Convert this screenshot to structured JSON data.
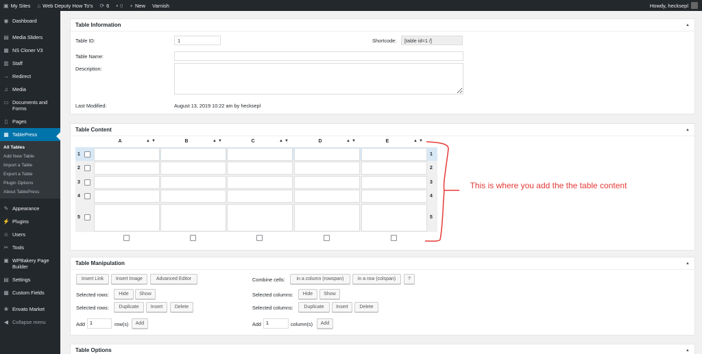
{
  "adminbar": {
    "my_sites": "My Sites",
    "site_name": "Web Deputy How To's",
    "updates": "6",
    "comments": "0",
    "new": "New",
    "varnish": "Varnish",
    "howdy": "Howdy, hecksepl"
  },
  "sidebar": {
    "items": [
      {
        "label": "Dashboard",
        "icon": "dashboard-icon"
      },
      {
        "label": "Media Sliders",
        "icon": "slider-icon"
      },
      {
        "label": "NS Cloner V3",
        "icon": "clone-icon"
      },
      {
        "label": "Staff",
        "icon": "staff-icon"
      },
      {
        "label": "Redirect",
        "icon": "redirect-icon"
      },
      {
        "label": "Media",
        "icon": "media-icon"
      },
      {
        "label": "Documents and Forms",
        "icon": "documents-icon"
      },
      {
        "label": "Pages",
        "icon": "pages-icon"
      },
      {
        "label": "TablePress",
        "icon": "table-icon"
      },
      {
        "label": "Appearance",
        "icon": "appearance-icon"
      },
      {
        "label": "Plugins",
        "icon": "plugins-icon"
      },
      {
        "label": "Users",
        "icon": "users-icon"
      },
      {
        "label": "Tools",
        "icon": "tools-icon"
      },
      {
        "label": "WPBakery Page Builder",
        "icon": "builder-icon"
      },
      {
        "label": "Settings",
        "icon": "settings-icon"
      },
      {
        "label": "Custom Fields",
        "icon": "custom-fields-icon"
      },
      {
        "label": "Envato Market",
        "icon": "envato-icon"
      },
      {
        "label": "Collapse menu",
        "icon": "collapse-icon"
      }
    ],
    "submenu": [
      "All Tables",
      "Add New Table",
      "Import a Table",
      "Export a Table",
      "Plugin Options",
      "About TablePress"
    ]
  },
  "table_info": {
    "title": "Table Information",
    "table_id_label": "Table ID:",
    "table_id_value": "1",
    "shortcode_label": "Shortcode:",
    "shortcode_value": "[table id=1 /]",
    "name_label": "Table Name:",
    "name_value": "",
    "description_label": "Description:",
    "description_value": "",
    "modified_label": "Last Modified:",
    "modified_value": "August 13, 2019 10:22 am by hecksepl"
  },
  "table_content": {
    "title": "Table Content",
    "columns": [
      "A",
      "B",
      "C",
      "D",
      "E"
    ],
    "rows": [
      "1",
      "2",
      "3",
      "4",
      "5"
    ]
  },
  "manipulation": {
    "title": "Table Manipulation",
    "insert_link": "Insert Link",
    "insert_image": "Insert Image",
    "advanced_editor": "Advanced Editor",
    "combine_cells_label": "Combine cells:",
    "in_column": "in a column (rowspan)",
    "in_row": "in a row (colspan)",
    "help": "?",
    "selected_rows_label": "Selected rows:",
    "selected_columns_label": "Selected columns:",
    "hide": "Hide",
    "show": "Show",
    "duplicate": "Duplicate",
    "insert": "Insert",
    "delete": "Delete",
    "add_label": "Add",
    "add_rows_value": "1",
    "rows_suffix": "row(s)",
    "add_cols_value": "1",
    "cols_suffix": "column(s)",
    "add_button": "Add"
  },
  "options": {
    "title": "Table Options"
  },
  "annotation": "This is where you add the the table content",
  "colors": {
    "adminbar_bg": "#23282d",
    "accent": "#0073aa",
    "annotation": "#e53935"
  }
}
